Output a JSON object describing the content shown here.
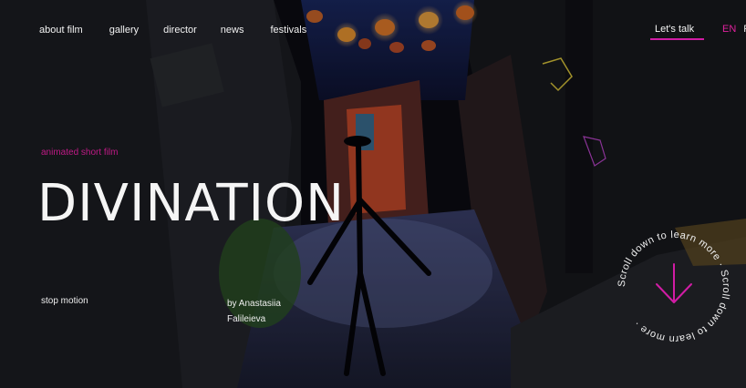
{
  "nav": {
    "items": [
      {
        "label": "about film"
      },
      {
        "label": "gallery"
      },
      {
        "label": "director"
      },
      {
        "label": "news"
      },
      {
        "label": "festivals"
      }
    ]
  },
  "cta": {
    "label": "Let's talk"
  },
  "lang": {
    "active": "EN",
    "other": "R"
  },
  "hero": {
    "kicker": "animated short film",
    "title": "DIVINATION",
    "technique": "stop motion",
    "author": "by Anastasiia Falileieva"
  },
  "scroll_badge": {
    "text": "Scroll down to learn more · Scroll down to learn more · "
  },
  "colors": {
    "accent": "#d11ca5",
    "bg": "#0b0b12"
  }
}
